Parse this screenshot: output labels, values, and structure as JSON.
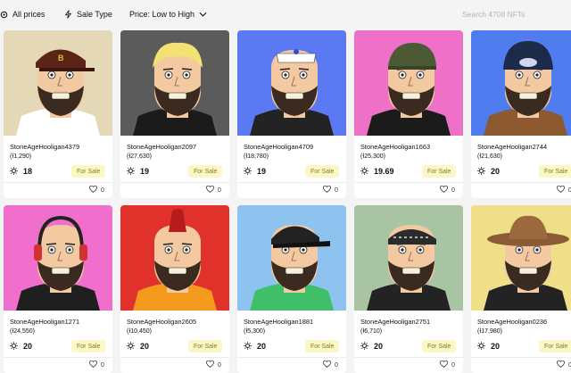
{
  "toolbar": {
    "filter_all": "All prices",
    "filter_sale": "Sale Type",
    "sort": "Price: Low to High",
    "search_placeholder": "Search 4708 NFTs"
  },
  "cards": [
    {
      "name": "StoneAgeHooligan4379",
      "price": "(Ɨ1,290)",
      "power": "18",
      "status": "For Sale",
      "likes": "0",
      "bg": "#e5d8b6",
      "shirt": "#ffffff",
      "hat": "cap-brown"
    },
    {
      "name": "StoneAgeHooligan2097",
      "price": "(Ɨ27,630)",
      "power": "19",
      "status": "For Sale",
      "likes": "0",
      "bg": "#5b5b5b",
      "shirt": "#1b1b1b",
      "hat": "blonde"
    },
    {
      "name": "StoneAgeHooligan4709",
      "price": "(Ɨ18,780)",
      "power": "19",
      "status": "For Sale",
      "likes": "0",
      "bg": "#5a79f2",
      "shirt": "#232323",
      "hat": "sailor"
    },
    {
      "name": "StoneAgeHooligan1663",
      "price": "(Ɨ25,300)",
      "power": "19.69",
      "status": "For Sale",
      "likes": "0",
      "bg": "#ef70c7",
      "shirt": "#1b1b1b",
      "hat": "army"
    },
    {
      "name": "StoneAgeHooligan2744",
      "price": "(Ɨ21,630)",
      "power": "20",
      "status": "For Sale",
      "likes": "0",
      "bg": "#4f7df0",
      "shirt": "#8c5a2e",
      "hat": "helmet"
    },
    {
      "name": "StoneAgeHooligan1271",
      "price": "(Ɨ24,550)",
      "power": "20",
      "status": "For Sale",
      "likes": "0",
      "bg": "#f06fcc",
      "shirt": "#1f1f1f",
      "hat": "headphones"
    },
    {
      "name": "StoneAgeHooligan2605",
      "price": "(Ɨ10,450)",
      "power": "20",
      "status": "For Sale",
      "likes": "0",
      "bg": "#e0312a",
      "shirt": "#f39a1f",
      "hat": "mohawk"
    },
    {
      "name": "StoneAgeHooligan1881",
      "price": "(Ɨ5,300)",
      "power": "20",
      "status": "For Sale",
      "likes": "0",
      "bg": "#8fc3ef",
      "shirt": "#3fbf67",
      "hat": "cap-black"
    },
    {
      "name": "StoneAgeHooligan2751",
      "price": "(Ɨ6,710)",
      "power": "20",
      "status": "For Sale",
      "likes": "0",
      "bg": "#a9c4a3",
      "shirt": "#232323",
      "hat": "bandana"
    },
    {
      "name": "StoneAgeHooligan0236",
      "price": "(Ɨ17,980)",
      "power": "20",
      "status": "For Sale",
      "likes": "0",
      "bg": "#efdf88",
      "shirt": "#232323",
      "hat": "cowboy"
    }
  ]
}
